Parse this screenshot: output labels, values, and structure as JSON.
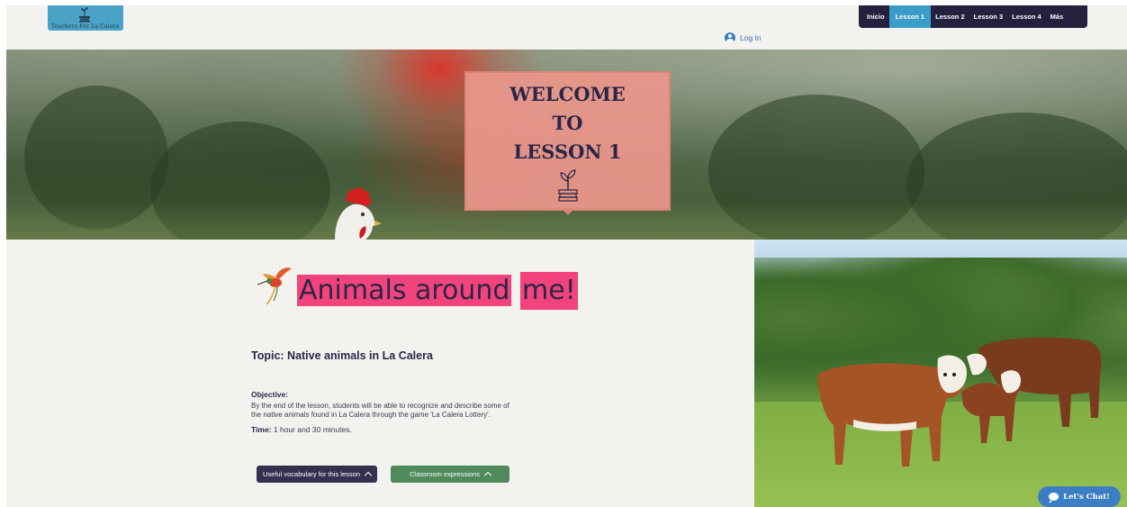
{
  "header": {
    "logo_text": "Teachers For La Calera",
    "nav_items": [
      {
        "label": "Inicio",
        "active": false
      },
      {
        "label": "Lesson 1",
        "active": true
      },
      {
        "label": "Lesson 2",
        "active": false
      },
      {
        "label": "Lesson 3",
        "active": false
      },
      {
        "label": "Lesson 4",
        "active": false
      },
      {
        "label": "Más",
        "active": false
      }
    ],
    "login_label": "Log In"
  },
  "hero": {
    "welcome_lines": [
      "WELCOME",
      "TO",
      "LESSON 1"
    ]
  },
  "lesson": {
    "title_line1": "Animals around",
    "title_line2": "me!",
    "topic": "Topic: Native animals in La Calera",
    "objective_label": "Objective:",
    "objective_text": "By the end of the lesson, students will be able to recognize and describe some of the native animals found in La Calera through the game 'La Calera Lottery'.",
    "time_label": "Time:",
    "time_value": " 1 hour and 30 minutes.",
    "buttons": {
      "vocab": "Useful vocabulary for this lesson",
      "classroom": "Classroom expressions"
    }
  },
  "chat": {
    "label": "Let's Chat!"
  },
  "colors": {
    "nav_bg": "#24203f",
    "nav_active": "#3b9cc7",
    "title_highlight": "#f2437c",
    "welcome_box": "#e9968a",
    "btn_vocab": "#34304f",
    "btn_classroom": "#4f8a5a",
    "chat_bg": "#3b7ec4"
  },
  "icons": [
    "plant-on-books-icon",
    "user-icon",
    "hummingbird-icon",
    "chevron-up-icon",
    "chat-bubble-icon"
  ]
}
